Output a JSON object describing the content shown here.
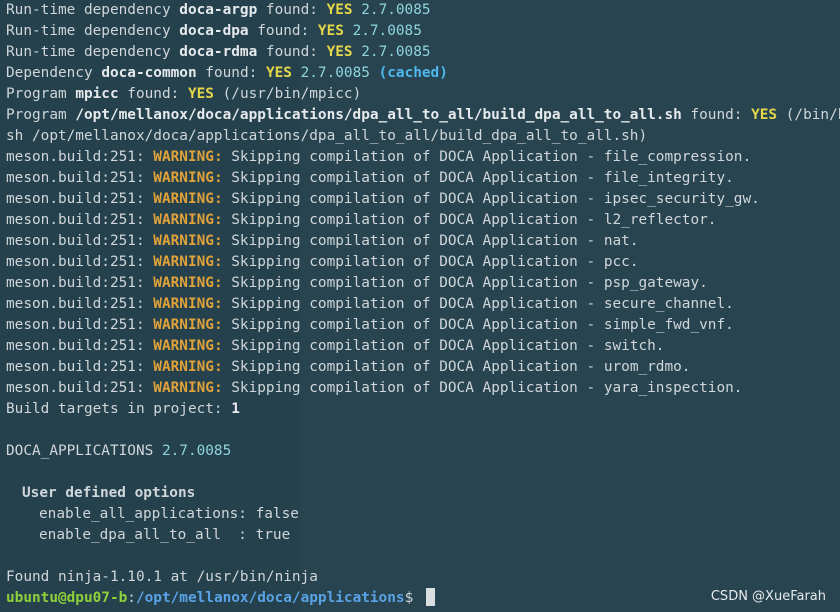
{
  "deps": [
    {
      "prefix": "Run-time dependency ",
      "name": "doca-argp",
      "mid": " found: ",
      "yes": "YES",
      "ver": " 2.7.0085"
    },
    {
      "prefix": "Run-time dependency ",
      "name": "doca-dpa",
      "mid": " found: ",
      "yes": "YES",
      "ver": " 2.7.0085"
    },
    {
      "prefix": "Run-time dependency ",
      "name": "doca-rdma",
      "mid": " found: ",
      "yes": "YES",
      "ver": " 2.7.0085"
    }
  ],
  "dep_common": {
    "prefix": "Dependency ",
    "name": "doca-common",
    "mid": " found: ",
    "yes": "YES",
    "ver": " 2.7.0085 ",
    "cached": "(cached)"
  },
  "program_mpicc": {
    "prefix": "Program ",
    "name": "mpicc",
    "mid": " found: ",
    "yes": "YES",
    "rest": " (/usr/bin/mpicc)"
  },
  "program_build": {
    "prefix": "Program ",
    "name": "/opt/mellanox/doca/applications/dpa_all_to_all/build_dpa_all_to_all.sh",
    "mid": " found: ",
    "yes": "YES",
    "rest": " (/bin/ba",
    "cont": "sh /opt/mellanox/doca/applications/dpa_all_to_all/build_dpa_all_to_all.sh)"
  },
  "warning_prefix": "meson.build:251: ",
  "warning_label": "WARNING:",
  "warning_text": " Skipping compilation of DOCA Application - ",
  "warnings": [
    "file_compression.",
    "file_integrity.",
    "ipsec_security_gw.",
    "l2_reflector.",
    "nat.",
    "pcc.",
    "psp_gateway.",
    "secure_channel.",
    "simple_fwd_vnf.",
    "switch.",
    "urom_rdmo.",
    "yara_inspection."
  ],
  "build_targets": {
    "label": "Build targets in project: ",
    "value": "1"
  },
  "doca_apps": {
    "label": "DOCA_APPLICATIONS ",
    "ver": "2.7.0085"
  },
  "user_options": {
    "title": "User defined options",
    "opt1": "enable_all_applications: false",
    "opt2": "enable_dpa_all_to_all  : true"
  },
  "ninja": "Found ninja-1.10.1 at /usr/bin/ninja",
  "prompt": {
    "user": "ubuntu@dpu07-b",
    "sep": ":",
    "path": "/opt/mellanox/doca/applications",
    "symbol": "$ "
  },
  "watermark": "CSDN @XueFarah",
  "colors": {
    "yes": "#e5d64a",
    "warning": "#e0a23a",
    "version": "#8fd4de",
    "cached": "#4fb9ee",
    "prompt_user": "#8fd13a",
    "prompt_path": "#5aa3e6"
  }
}
